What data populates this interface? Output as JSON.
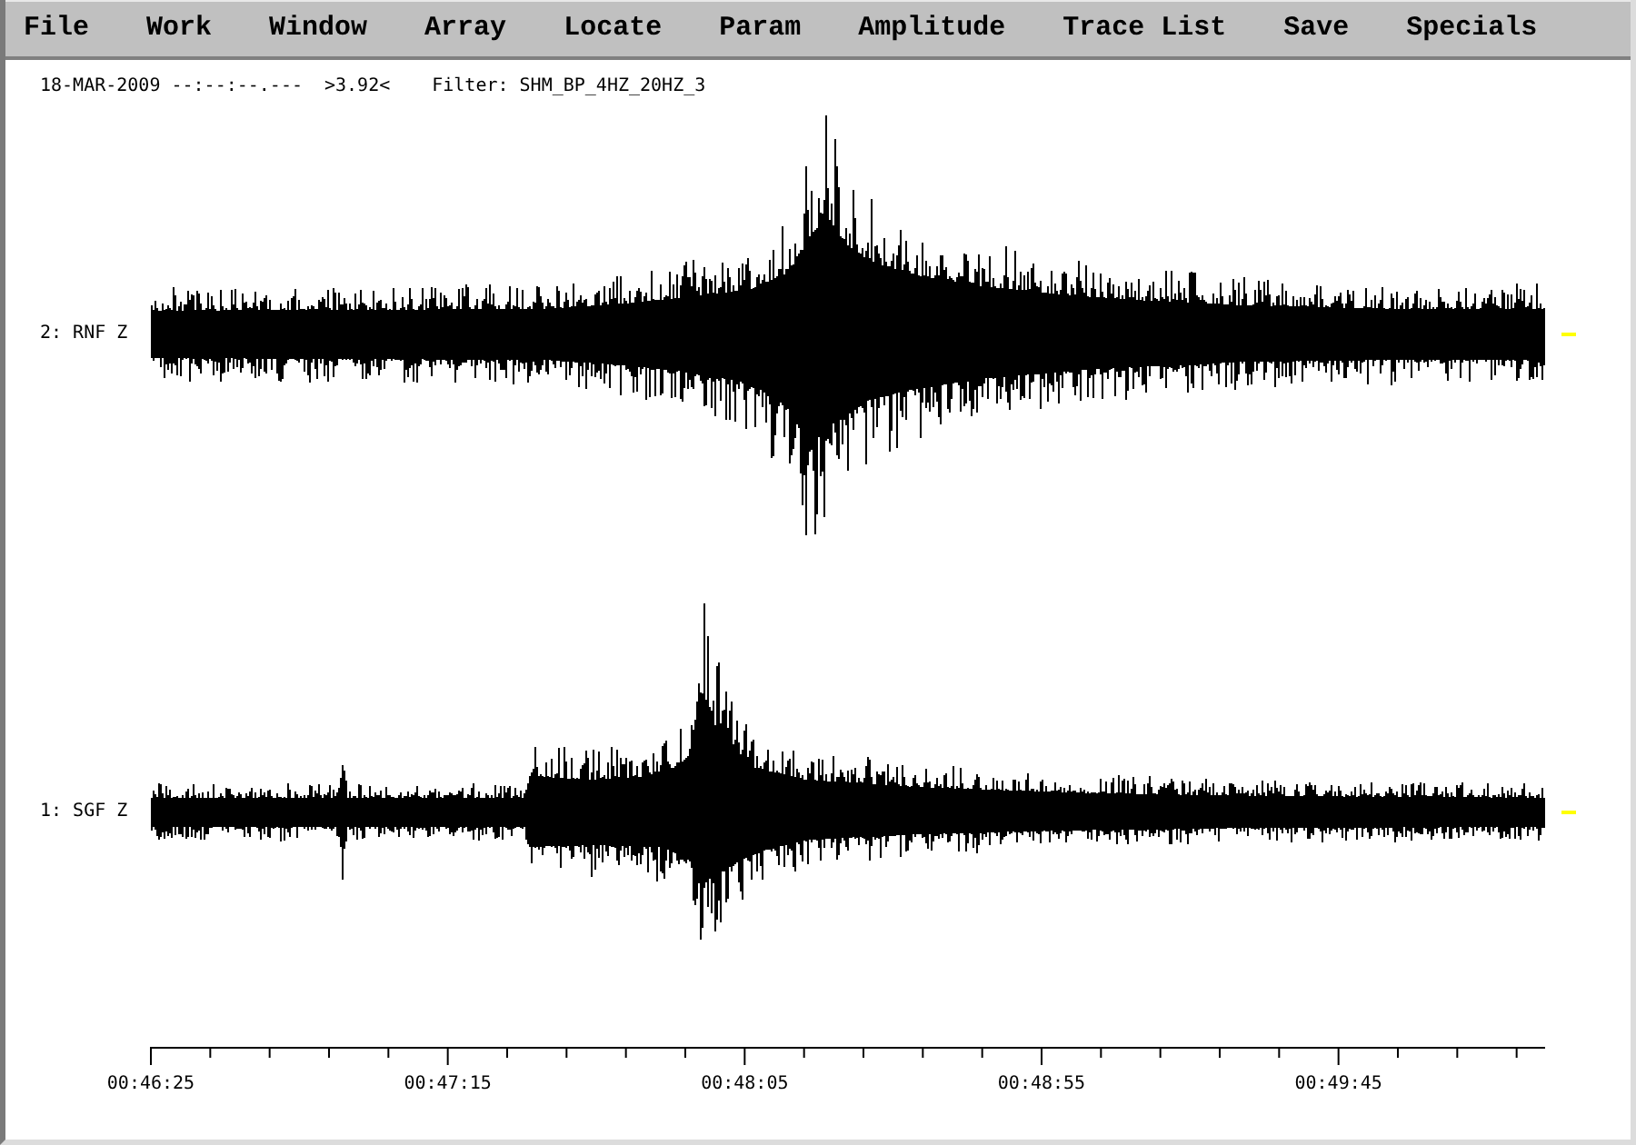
{
  "menu_bar": {
    "items": [
      "File",
      "Work",
      "Window",
      "Array",
      "Locate",
      "Param",
      "Amplitude",
      "Trace List",
      "Save",
      "Specials"
    ]
  },
  "header": {
    "date_time": "18-MAR-2009 --:--:--.---",
    "value": ">3.92<",
    "filter": "Filter: SHM_BP_4HZ_20HZ_3"
  },
  "traces": [
    {
      "label": "2: RNF Z"
    },
    {
      "label": "1: SGF Z"
    }
  ],
  "time_axis": {
    "labels": [
      "00:46:25",
      "00:47:15",
      "00:48:05",
      "00:48:55",
      "00:49:45"
    ]
  }
}
